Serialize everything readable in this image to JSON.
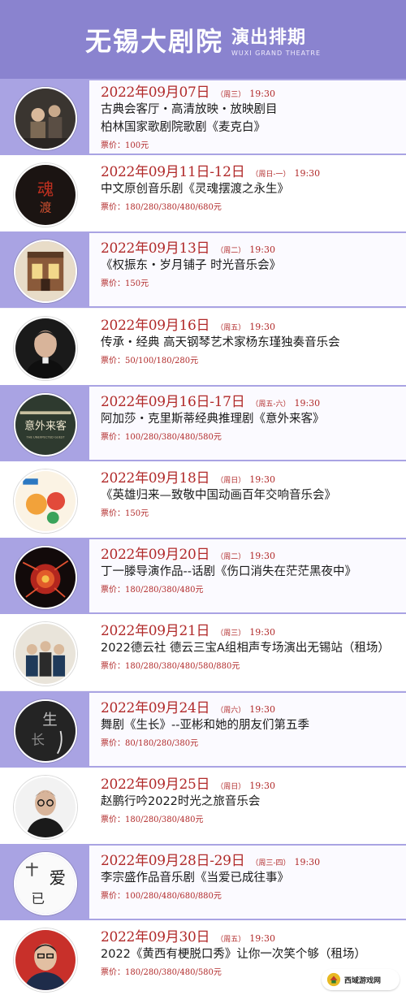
{
  "header": {
    "title": "无锡大剧院",
    "subtitle": "演出排期",
    "english": "WUXI GRAND THEATRE",
    "bg_color": "#8a83cf"
  },
  "colors": {
    "accent_red": "#b12a2a",
    "purple_row": "#a9a3e3"
  },
  "events": [
    {
      "date": "2022年09月07日",
      "weekday": "（周三）",
      "time": "19:30",
      "lines": [
        "古典会客厅・高清放映・放映剧目",
        "柏林国家歌剧院歌剧《麦克白》"
      ],
      "price": "票价：100元"
    },
    {
      "date": "2022年09月11日-12日",
      "weekday": "（周日-一）",
      "time": "19:30",
      "lines": [
        "中文原创音乐剧《灵魂摆渡之永生》"
      ],
      "price": "票价：180/280/380/480/680元"
    },
    {
      "date": "2022年09月13日",
      "weekday": "（周二）",
      "time": "19:30",
      "lines": [
        "《权振东・岁月铺子 时光音乐会》"
      ],
      "price": "票价：150元"
    },
    {
      "date": "2022年09月16日",
      "weekday": "（周五）",
      "time": "19:30",
      "lines": [
        "传承・经典 高天钢琴艺术家杨东瑾独奏音乐会"
      ],
      "price": "票价：50/100/180/280元"
    },
    {
      "date": "2022年09月16日-17日",
      "weekday": "（周五-六）",
      "time": "19:30",
      "lines": [
        "阿加莎・克里斯蒂经典推理剧《意外来客》"
      ],
      "price": "票价：100/280/380/480/580元"
    },
    {
      "date": "2022年09月18日",
      "weekday": "（周日）",
      "time": "19:30",
      "lines": [
        "《英雄归来—致敬中国动画百年交响音乐会》"
      ],
      "price": "票价：150元"
    },
    {
      "date": "2022年09月20日",
      "weekday": "（周二）",
      "time": "19:30",
      "lines": [
        "丁一滕导演作品--话剧《伤口消失在茫茫黑夜中》"
      ],
      "price": "票价：180/280/380/480元"
    },
    {
      "date": "2022年09月21日",
      "weekday": "（周三）",
      "time": "19:30",
      "lines": [
        "2022德云社 德云三宝A组相声专场演出无锡站（租场）"
      ],
      "price": "票价：180/280/380/480/580/880元"
    },
    {
      "date": "2022年09月24日",
      "weekday": "（周六）",
      "time": "19:30",
      "lines": [
        "舞剧《生长》--亚彬和她的朋友们第五季"
      ],
      "price": "票价：80/180/280/380元"
    },
    {
      "date": "2022年09月25日",
      "weekday": "（周日）",
      "time": "19:30",
      "lines": [
        "赵鹏行吟2022时光之旅音乐会"
      ],
      "price": "票价：180/280/380/480元"
    },
    {
      "date": "2022年09月28日-29日",
      "weekday": "（周三-四）",
      "time": "19:30",
      "lines": [
        "李宗盛作品音乐剧《当爱已成往事》"
      ],
      "price": "票价：100/280/480/680/880元"
    },
    {
      "date": "2022年09月30日",
      "weekday": "（周五）",
      "time": "19:30",
      "lines": [
        "2022《黄西有梗脱口秀》让你一次笑个够（租场）"
      ],
      "price": "票价：180/280/380/480/580元"
    }
  ],
  "thumb_icons": [
    "opera-scene",
    "ferry-poster",
    "shop-facade",
    "pianist-portrait",
    "stage-poster",
    "animation-poster",
    "red-explosion",
    "crosstalk-group",
    "dance-poster",
    "singer-portrait",
    "calligraphy-poster",
    "comedian-portrait"
  ],
  "watermark": {
    "text": "西域游戏网"
  }
}
